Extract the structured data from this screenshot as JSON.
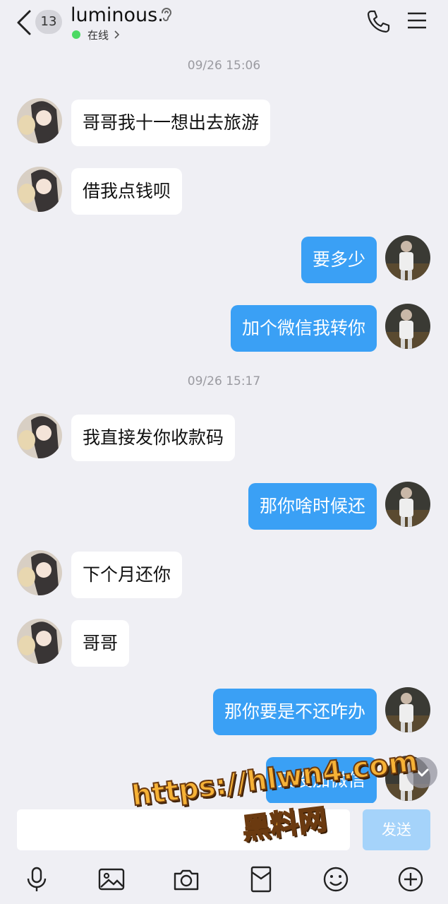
{
  "header": {
    "unread_count": "13",
    "contact_name": "luminous.",
    "status": "在线"
  },
  "timestamps": [
    "09/26 15:06",
    "09/26 15:17"
  ],
  "messages": [
    {
      "side": "left",
      "text": "哥哥我十一想出去旅游"
    },
    {
      "side": "left",
      "text": "借我点钱呗"
    },
    {
      "side": "right",
      "text": "要多少"
    },
    {
      "side": "right",
      "text": "加个微信我转你"
    },
    {
      "side": "left",
      "text": "我直接发你收款码"
    },
    {
      "side": "right",
      "text": "那你啥时候还"
    },
    {
      "side": "left",
      "text": "下个月还你"
    },
    {
      "side": "left",
      "text": "哥哥"
    },
    {
      "side": "right",
      "text": "那你要是不还咋办"
    },
    {
      "side": "right",
      "text": "又没加微信"
    }
  ],
  "input": {
    "value": "",
    "send_label": "发送"
  },
  "toolbar": [
    "microphone-icon",
    "image-icon",
    "camera-icon",
    "red-packet-icon",
    "emoji-icon",
    "plus-icon"
  ],
  "watermark": {
    "url": "https://hlwn4.com",
    "name": "黑料网"
  },
  "colors": {
    "background": "#efeff4",
    "sent_bubble": "#3aa0f5",
    "received_bubble": "#ffffff",
    "send_button": "#a5d3fa",
    "online": "#4cd964"
  }
}
